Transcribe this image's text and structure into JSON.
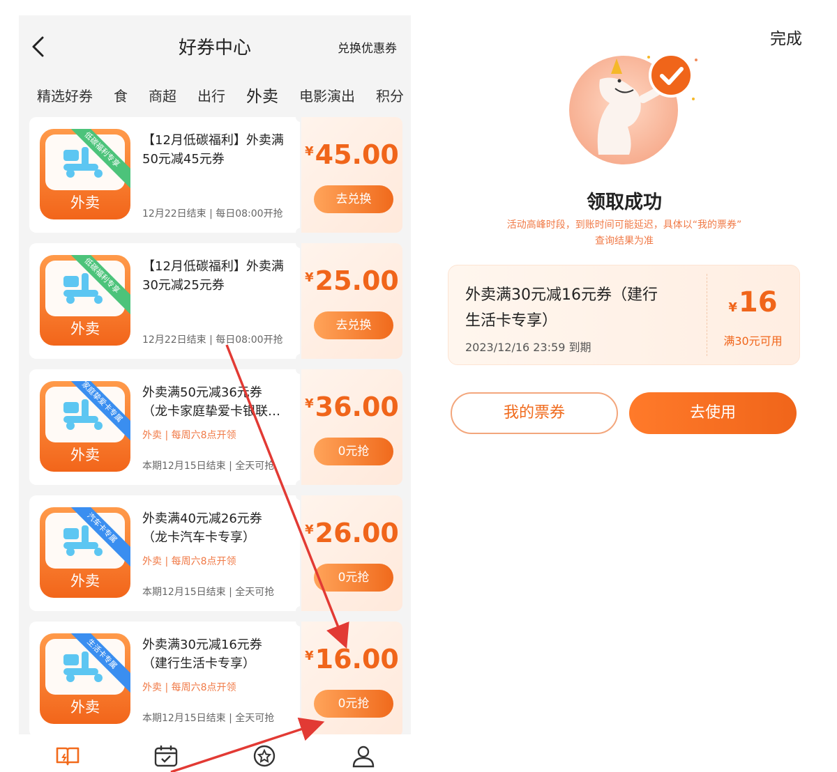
{
  "left": {
    "header": {
      "title": "好券中心",
      "exchange": "兑换优惠券"
    },
    "tabs": [
      {
        "label": "精选好券"
      },
      {
        "label": "食"
      },
      {
        "label": "商超"
      },
      {
        "label": "出行"
      },
      {
        "label": "外卖",
        "active": true
      },
      {
        "label": "电影演出"
      },
      {
        "label": "积分"
      }
    ],
    "coupons": [
      {
        "title_line1": "【12月低碳福利】外卖满",
        "title_line2": "50元减45元券",
        "tag": "",
        "footer": "12月22日结束 | 每日08:00开抢",
        "price_symbol": "¥",
        "price": "45.00",
        "button": "去兑换",
        "ribbon": "低碳福利专享",
        "ribbon_color": "#4cc37a",
        "thumb_label": "外卖"
      },
      {
        "title_line1": "【12月低碳福利】外卖满",
        "title_line2": "30元减25元券",
        "tag": "",
        "footer": "12月22日结束 | 每日08:00开抢",
        "price_symbol": "¥",
        "price": "25.00",
        "button": "去兑换",
        "ribbon": "低碳福利专享",
        "ribbon_color": "#4cc37a",
        "thumb_label": "外卖"
      },
      {
        "title_line1": "外卖满50元减36元券",
        "title_line2": "（龙卡家庭挚爱卡银联…",
        "tag": "外卖 | 每周六8点开领",
        "footer": "本期12月15日结束 | 全天可抢",
        "price_symbol": "¥",
        "price": "36.00",
        "button": "0元抢",
        "ribbon": "家庭挚爱卡专属",
        "ribbon_color": "#3a8ef0",
        "thumb_label": "外卖"
      },
      {
        "title_line1": "外卖满40元减26元券",
        "title_line2": "（龙卡汽车卡专享）",
        "tag": "外卖 | 每周六8点开领",
        "footer": "本期12月15日结束 | 全天可抢",
        "price_symbol": "¥",
        "price": "26.00",
        "button": "0元抢",
        "ribbon": "汽车卡专属",
        "ribbon_color": "#3a8ef0",
        "thumb_label": "外卖"
      },
      {
        "title_line1": "外卖满30元减16元券",
        "title_line2": "（建行生活卡专享）",
        "tag": "外卖 | 每周六8点开领",
        "footer": "本期12月15日结束 | 全天可抢",
        "price_symbol": "¥",
        "price": "16.00",
        "button": "0元抢",
        "ribbon": "生活卡专属",
        "ribbon_color": "#3a8ef0",
        "thumb_label": "外卖"
      }
    ],
    "bottom_nav": [
      {
        "icon": "book-icon",
        "color": "#f26a1b"
      },
      {
        "icon": "calendar-icon",
        "color": "#333333"
      },
      {
        "icon": "star-badge-icon",
        "color": "#333333"
      },
      {
        "icon": "user-icon",
        "color": "#333333"
      }
    ]
  },
  "right": {
    "done": "完成",
    "success_title": "领取成功",
    "success_note_line1": "活动高峰时段，到账时间可能延迟，具体以“我的票券”",
    "success_note_line2": "查询结果为准",
    "coupon": {
      "title_line1": "外卖满30元减16元券（建行",
      "title_line2": "生活卡专享）",
      "expiry": "2023/12/16 23:59 到期",
      "symbol": "¥",
      "amount": "16",
      "condition": "满30元可用"
    },
    "btn_my_tickets": "我的票券",
    "btn_use": "去使用"
  },
  "colors": {
    "accent": "#f0651a",
    "accent_light": "#ffa45a",
    "arrow": "#e23a34"
  }
}
